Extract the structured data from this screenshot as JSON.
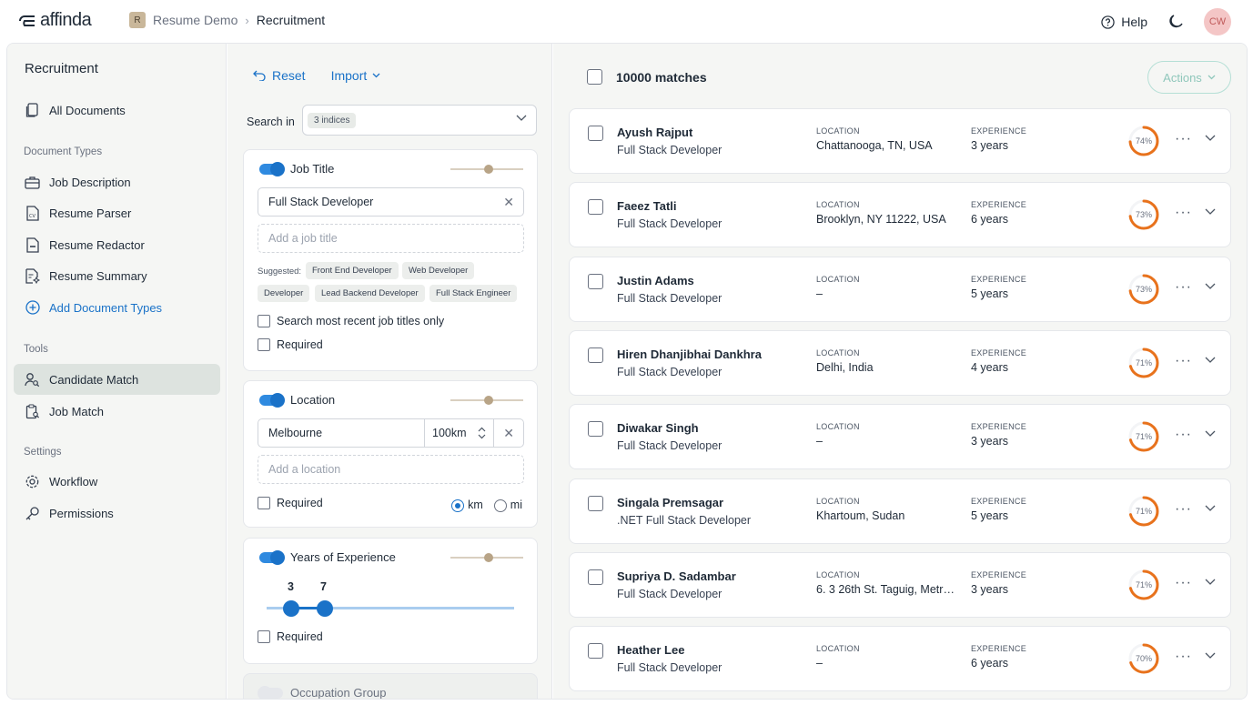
{
  "header": {
    "brand": "affinda",
    "project_badge": "R",
    "project": "Resume Demo",
    "current": "Recruitment",
    "help": "Help",
    "avatar": "CW"
  },
  "sidebar": {
    "title": "Recruitment",
    "all_documents": "All Documents",
    "section_doc_types": "Document Types",
    "doc_types": [
      "Job Description",
      "Resume Parser",
      "Resume Redactor",
      "Resume Summary"
    ],
    "add_doc_types": "Add Document Types",
    "section_tools": "Tools",
    "tools": [
      "Candidate Match",
      "Job Match"
    ],
    "section_settings": "Settings",
    "settings": [
      "Workflow",
      "Permissions"
    ]
  },
  "filters": {
    "reset": "Reset",
    "import": "Import",
    "search_in_label": "Search in",
    "indices_chip": "3 indices",
    "job_title": {
      "label": "Job Title",
      "value": "Full Stack Developer",
      "placeholder": "Add a job title",
      "suggested_label": "Suggested:",
      "suggestions": [
        "Front End Developer",
        "Web Developer",
        "Developer",
        "Lead Backend Developer",
        "Full Stack Engineer"
      ],
      "recent_only": "Search most recent job titles only",
      "required": "Required"
    },
    "location": {
      "label": "Location",
      "value": "Melbourne",
      "distance": "100km",
      "placeholder": "Add a location",
      "required": "Required",
      "unit_km": "km",
      "unit_mi": "mi"
    },
    "experience": {
      "label": "Years of Experience",
      "min": "3",
      "max": "7",
      "required": "Required"
    },
    "occupation_group": {
      "label": "Occupation Group"
    }
  },
  "results": {
    "count": "10000 matches",
    "actions": "Actions",
    "location_label": "LOCATION",
    "experience_label": "EXPERIENCE",
    "accent_color": "#e8721c",
    "rows": [
      {
        "name": "Ayush Rajput",
        "title": "Full Stack Developer",
        "location": "Chattanooga, TN, USA",
        "experience": "3 years",
        "score": "74%"
      },
      {
        "name": "Faeez Tatli",
        "title": "Full Stack Developer",
        "location": "Brooklyn, NY 11222, USA",
        "experience": "6 years",
        "score": "73%"
      },
      {
        "name": "Justin Adams",
        "title": "Full Stack Developer",
        "location": "–",
        "experience": "5 years",
        "score": "73%"
      },
      {
        "name": "Hiren Dhanjibhai Dankhra",
        "title": "Full Stack Developer",
        "location": "Delhi, India",
        "experience": "4 years",
        "score": "71%"
      },
      {
        "name": "Diwakar Singh",
        "title": "Full Stack Developer",
        "location": "–",
        "experience": "3 years",
        "score": "71%"
      },
      {
        "name": "Singala Premsagar",
        "title": ".NET Full Stack Developer",
        "location": "Khartoum, Sudan",
        "experience": "5 years",
        "score": "71%"
      },
      {
        "name": "Supriya D. Sadambar",
        "title": "Full Stack Developer",
        "location": "6. 3 26th St. Taguig, Metro ...",
        "experience": "3 years",
        "score": "71%"
      },
      {
        "name": "Heather Lee",
        "title": "Full Stack Developer",
        "location": "–",
        "experience": "6 years",
        "score": "70%"
      }
    ]
  }
}
